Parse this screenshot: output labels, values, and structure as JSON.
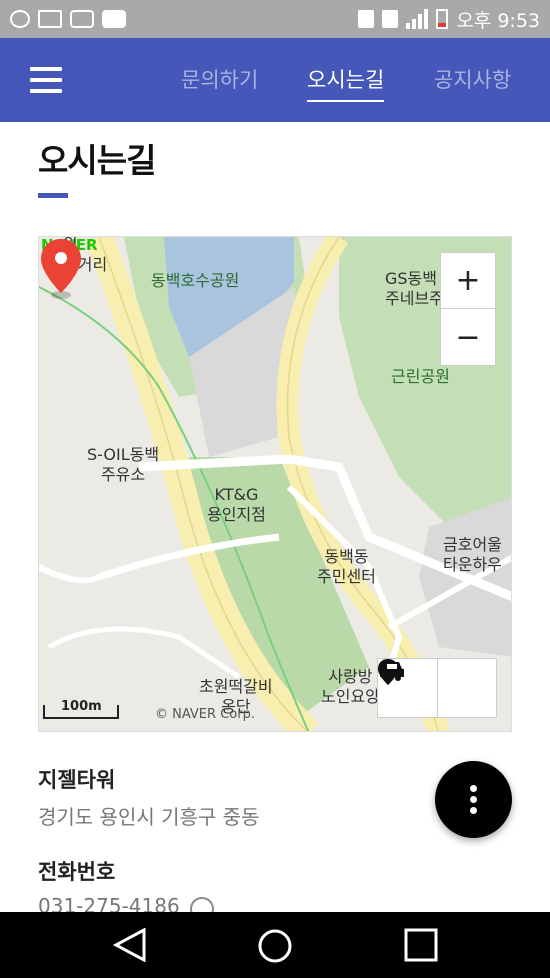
{
  "status_bar": {
    "left_icons": [
      "uplus-icon",
      "mail-icon",
      "band-icon",
      "youtube-icon"
    ],
    "right_icons": [
      "nfc-icon",
      "lte-icon",
      "signal-icon",
      "battery-icon"
    ],
    "time": "오후 9:53"
  },
  "app_bar": {
    "menu_icon": "hamburger-menu-icon",
    "tabs": [
      {
        "label": "문의하기",
        "active": false
      },
      {
        "label": "오시는길",
        "active": true
      },
      {
        "label": "공지사항",
        "active": false
      }
    ]
  },
  "page": {
    "title": "오시는길"
  },
  "map": {
    "provider_logo": "NAVER",
    "labels": {
      "top_left": "원\n삼거리",
      "lake_park": "동백호수공원",
      "gs_station": "GS동백\n주네브주",
      "neighborhood_park": "근린공원",
      "soil_station": "S-OIL동백\n주유소",
      "ktg": "KT&G\n용인지점",
      "community_center": "동백동\n주민센터",
      "kumho": "금호어울\n타운하우",
      "restaurant": "초원떡갈비\n옹단",
      "senior_center": "사랑방\n노인요양"
    },
    "zoom_in_label": "+",
    "zoom_out_label": "−",
    "scale_label": "100m",
    "copyright": "© NAVER Corp.",
    "buttons": [
      "location-pin-icon",
      "car-route-icon"
    ],
    "colors": {
      "park": "#c4dfb5",
      "water": "#a9c4df",
      "road": "#f7eeb0",
      "land": "#eceae4"
    }
  },
  "info": {
    "name": "지젤타워",
    "address": "경기도 용인시 기흥구 중동",
    "tel_heading": "전화번호",
    "tel": "031-275-4186"
  },
  "fab_icon": "more-vertical-icon",
  "nav_bar": [
    "back-icon",
    "home-icon",
    "recents-icon"
  ],
  "colors": {
    "brand": "#4557b8",
    "pin": "#ea4335"
  }
}
